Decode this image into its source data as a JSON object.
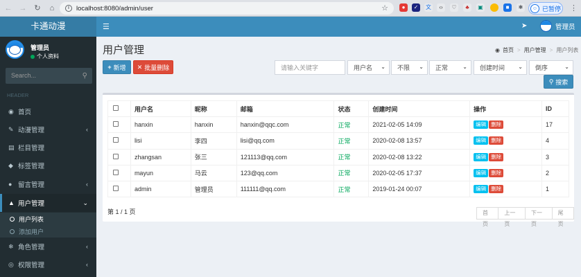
{
  "browser": {
    "url": "localhost:8080/admin/user",
    "profile_label": "已暂停"
  },
  "app": {
    "logo": "卡通动漫",
    "top_user": "管理员"
  },
  "sidebar": {
    "user_name": "管理员",
    "user_status": "个人资料",
    "search_placeholder": "Search...",
    "header_label": "HEADER",
    "items": [
      {
        "label": "首页",
        "icon": "dashboard-icon"
      },
      {
        "label": "动漫管理",
        "icon": "paint-brush-icon"
      },
      {
        "label": "栏目管理",
        "icon": "book-icon"
      },
      {
        "label": "标签管理",
        "icon": "tag-icon"
      },
      {
        "label": "留言管理",
        "icon": "comment-icon"
      },
      {
        "label": "用户管理",
        "icon": "user-icon"
      },
      {
        "label": "角色管理",
        "icon": "snowflake-icon"
      },
      {
        "label": "权限管理",
        "icon": "compass-icon"
      }
    ],
    "sub_items": [
      {
        "label": "用户列表"
      },
      {
        "label": "添加用户"
      }
    ]
  },
  "page": {
    "title": "用户管理",
    "breadcrumb": [
      "首页",
      "用户管理",
      "用户列表"
    ]
  },
  "toolbar": {
    "add_label": "新增",
    "batch_delete_label": "批量删除",
    "keyword_placeholder": "请输入关键字",
    "filters": [
      "用户名",
      "不限",
      "正常",
      "创建时间",
      "倒序"
    ],
    "search_label": "搜索"
  },
  "table": {
    "columns": [
      "用户名",
      "昵称",
      "邮箱",
      "状态",
      "创建时间",
      "操作",
      "ID"
    ],
    "edit_label": "编辑",
    "delete_label": "删除",
    "rows": [
      {
        "username": "hanxin",
        "nickname": "hanxin",
        "email": "hanxin@qqc.com",
        "status": "正常",
        "created": "2021-02-05 14:09",
        "id": "17"
      },
      {
        "username": "lisi",
        "nickname": "李四",
        "email": "lisi@qq.com",
        "status": "正常",
        "created": "2020-02-08 13:57",
        "id": "4"
      },
      {
        "username": "zhangsan",
        "nickname": "张三",
        "email": "121113@qq.com",
        "status": "正常",
        "created": "2020-02-08 13:22",
        "id": "3"
      },
      {
        "username": "mayun",
        "nickname": "马云",
        "email": "123@qq.com",
        "status": "正常",
        "created": "2020-02-05 17:37",
        "id": "2"
      },
      {
        "username": "admin",
        "nickname": "管理员",
        "email": "111111@qq.com",
        "status": "正常",
        "created": "2019-01-24 00:07",
        "id": "1"
      }
    ]
  },
  "pagination": {
    "info": "第 1 / 1 页",
    "buttons": [
      "首页",
      "上一页",
      "下一页",
      "尾页"
    ]
  }
}
